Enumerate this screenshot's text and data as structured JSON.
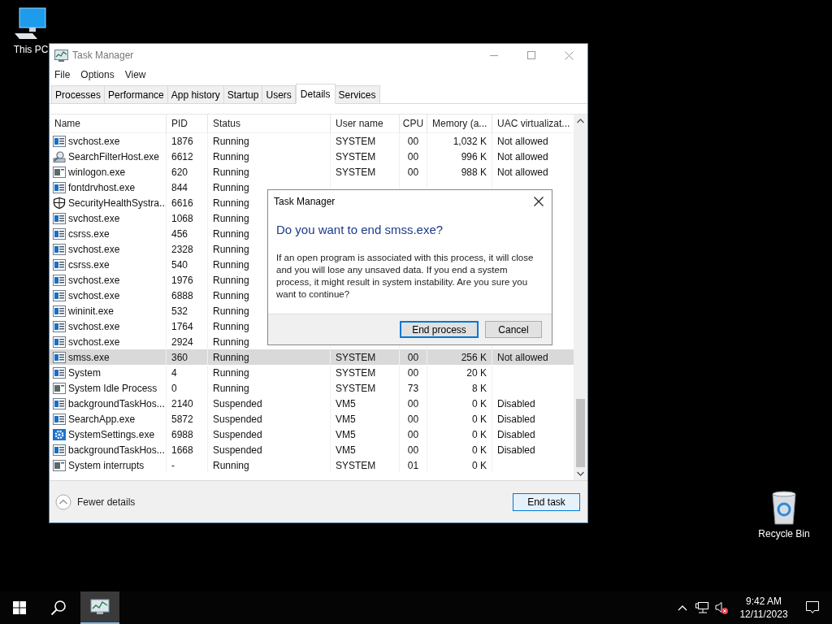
{
  "desktop_icons": [
    {
      "kind": "pc",
      "label": "This PC"
    },
    {
      "kind": "bin",
      "label": "Recycle Bin"
    }
  ],
  "window": {
    "title": "Task Manager",
    "menu": [
      "File",
      "Options",
      "View"
    ],
    "tabs": [
      {
        "label": "Processes",
        "selected": false
      },
      {
        "label": "Performance",
        "selected": false
      },
      {
        "label": "App history",
        "selected": false
      },
      {
        "label": "Startup",
        "selected": false
      },
      {
        "label": "Users",
        "selected": false
      },
      {
        "label": "Details",
        "selected": true
      },
      {
        "label": "Services",
        "selected": false
      }
    ],
    "table": {
      "columns": [
        "Name",
        "PID",
        "Status",
        "User name",
        "CPU",
        "Memory (a...",
        "UAC virtualizat..."
      ],
      "rows": [
        {
          "kind": "app",
          "cells": [
            "svchost.exe",
            "1876",
            "Running",
            "SYSTEM",
            "00",
            "1,032 K",
            "Not allowed"
          ],
          "selected": false
        },
        {
          "kind": "search",
          "cells": [
            "SearchFilterHost.exe",
            "6612",
            "Running",
            "SYSTEM",
            "00",
            "996 K",
            "Not allowed"
          ],
          "selected": false
        },
        {
          "kind": "window",
          "cells": [
            "winlogon.exe",
            "620",
            "Running",
            "SYSTEM",
            "00",
            "988 K",
            "Not allowed"
          ],
          "selected": false
        },
        {
          "kind": "app",
          "cells": [
            "fontdrvhost.exe",
            "844",
            "Running"
          ],
          "selected": false
        },
        {
          "kind": "shield",
          "cells": [
            "SecurityHealthSystra...",
            "6616",
            "Running"
          ],
          "selected": false
        },
        {
          "kind": "app",
          "cells": [
            "svchost.exe",
            "1068",
            "Running"
          ],
          "selected": false
        },
        {
          "kind": "app",
          "cells": [
            "csrss.exe",
            "456",
            "Running"
          ],
          "selected": false
        },
        {
          "kind": "app",
          "cells": [
            "svchost.exe",
            "2328",
            "Running"
          ],
          "selected": false
        },
        {
          "kind": "app",
          "cells": [
            "csrss.exe",
            "540",
            "Running"
          ],
          "selected": false
        },
        {
          "kind": "app",
          "cells": [
            "svchost.exe",
            "1976",
            "Running"
          ],
          "selected": false
        },
        {
          "kind": "app",
          "cells": [
            "svchost.exe",
            "6888",
            "Running"
          ],
          "selected": false
        },
        {
          "kind": "app",
          "cells": [
            "wininit.exe",
            "532",
            "Running"
          ],
          "selected": false
        },
        {
          "kind": "app",
          "cells": [
            "svchost.exe",
            "1764",
            "Running"
          ],
          "selected": false
        },
        {
          "kind": "app",
          "cells": [
            "svchost.exe",
            "2924",
            "Running"
          ],
          "selected": false
        },
        {
          "kind": "app",
          "cells": [
            "smss.exe",
            "360",
            "Running",
            "SYSTEM",
            "00",
            "256 K",
            "Not allowed"
          ],
          "selected": true
        },
        {
          "kind": "app",
          "cells": [
            "System",
            "4",
            "Running",
            "SYSTEM",
            "00",
            "20 K"
          ],
          "selected": false
        },
        {
          "kind": "window",
          "cells": [
            "System Idle Process",
            "0",
            "Running",
            "SYSTEM",
            "73",
            "8 K"
          ],
          "selected": false
        },
        {
          "kind": "app",
          "cells": [
            "backgroundTaskHos...",
            "2140",
            "Suspended",
            "VM5",
            "00",
            "0 K",
            "Disabled"
          ],
          "selected": false
        },
        {
          "kind": "app",
          "cells": [
            "SearchApp.exe",
            "5872",
            "Suspended",
            "VM5",
            "00",
            "0 K",
            "Disabled"
          ],
          "selected": false
        },
        {
          "kind": "gear",
          "cells": [
            "SystemSettings.exe",
            "6988",
            "Suspended",
            "VM5",
            "00",
            "0 K",
            "Disabled"
          ],
          "selected": false
        },
        {
          "kind": "app",
          "cells": [
            "backgroundTaskHos...",
            "1668",
            "Suspended",
            "VM5",
            "00",
            "0 K",
            "Disabled"
          ],
          "selected": false
        },
        {
          "kind": "window",
          "cells": [
            "System interrupts",
            "-",
            "Running",
            "SYSTEM",
            "01",
            "0 K"
          ],
          "selected": false
        }
      ]
    },
    "fewer_details": "Fewer details",
    "end_task": "End task"
  },
  "dialog": {
    "title": "Task Manager",
    "heading": "Do you want to end smss.exe?",
    "message": "If an open program is associated with this process, it will close and you will lose any unsaved data. If you end a system process, it might result in system instability. Are you sure you want to continue?",
    "buttons": [
      "End process",
      "Cancel"
    ]
  },
  "taskbar": {
    "time": "9:42 AM",
    "date": "12/11/2023"
  }
}
